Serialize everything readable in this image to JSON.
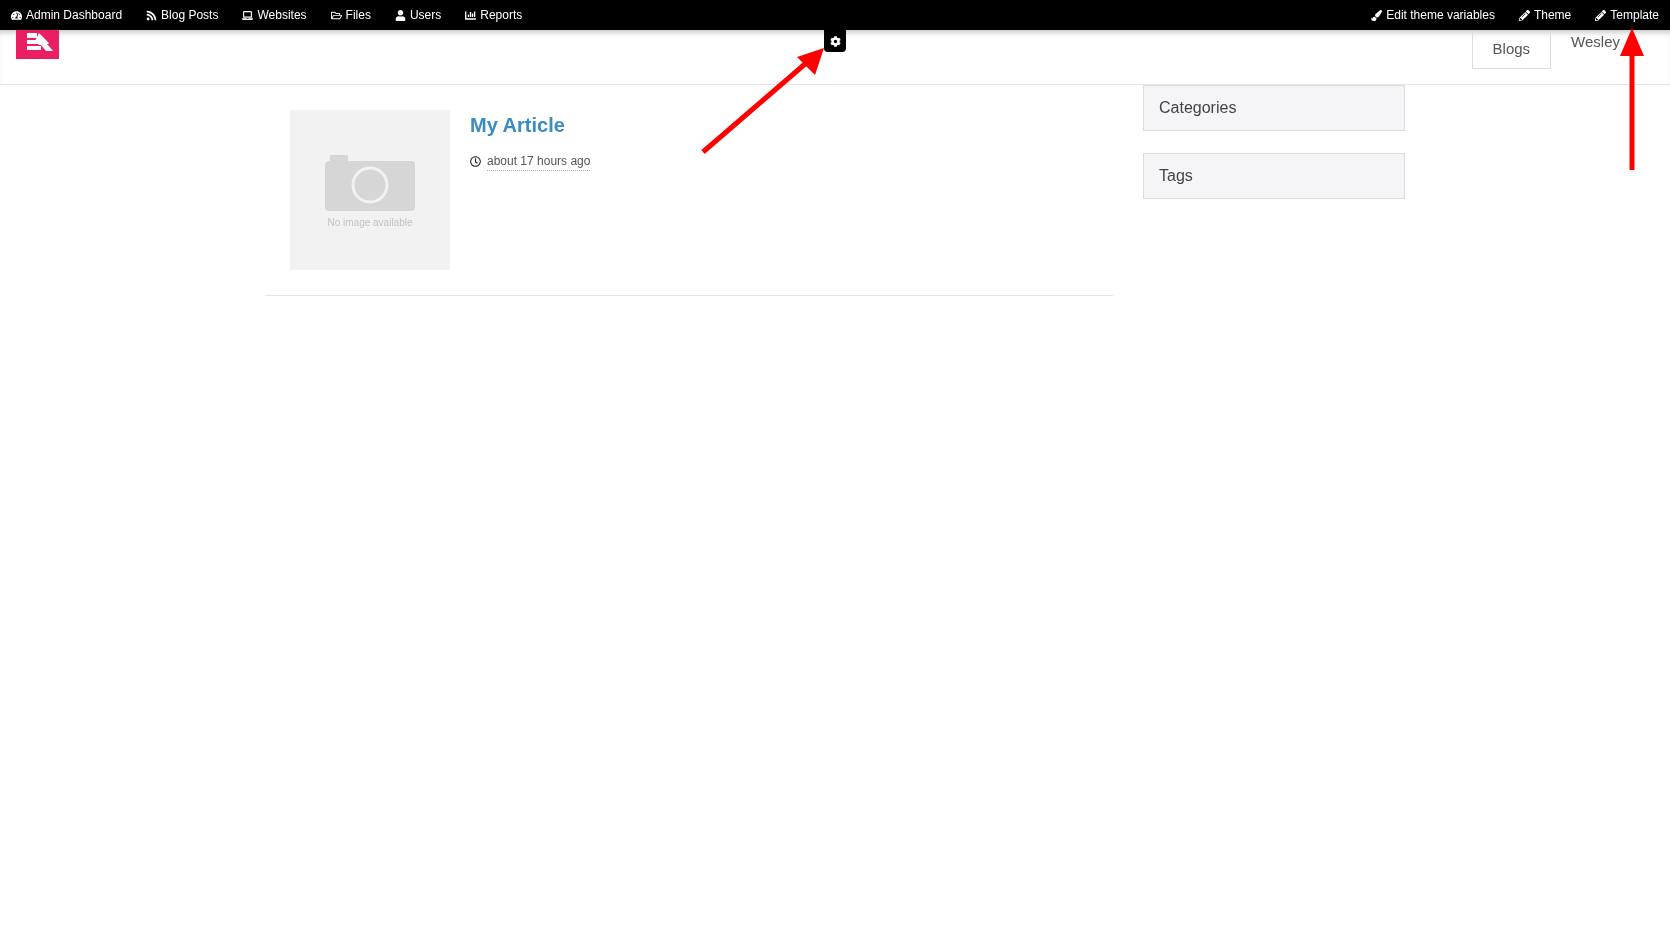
{
  "admin_bar": {
    "left": [
      {
        "kind": "dashboard",
        "label": "Admin Dashboard"
      },
      {
        "kind": "rss",
        "label": "Blog Posts"
      },
      {
        "kind": "laptop",
        "label": "Websites"
      },
      {
        "kind": "folder",
        "label": "Files"
      },
      {
        "kind": "user",
        "label": "Users"
      },
      {
        "kind": "chart",
        "label": "Reports"
      }
    ],
    "right": [
      {
        "kind": "brush",
        "label": "Edit theme variables"
      },
      {
        "kind": "pencil",
        "label": "Theme"
      },
      {
        "kind": "pencil",
        "label": "Template"
      }
    ]
  },
  "header": {
    "nav": [
      {
        "label": "Blogs",
        "selected": true
      },
      {
        "label": "Wesley",
        "selected": false
      }
    ]
  },
  "articles": [
    {
      "title": "My Article",
      "time": "about 17 hours ago",
      "image_caption": "No image available"
    }
  ],
  "sidebar": {
    "panels": [
      "Categories",
      "Tags"
    ]
  }
}
